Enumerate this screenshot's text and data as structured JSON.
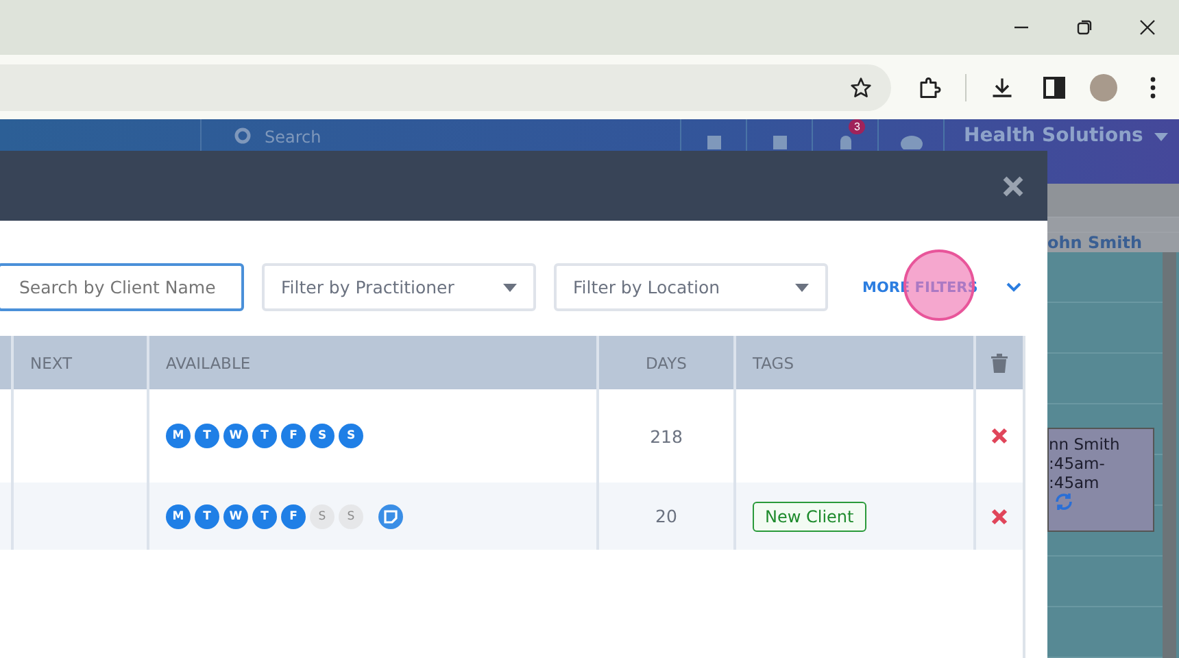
{
  "app_header": {
    "search_placeholder": "Search",
    "notification_count": "3",
    "org_name": "Health Solutions"
  },
  "background_calendar": {
    "column_heading": "ohn Smith",
    "appointment_lines": [
      "nn Smith",
      ":45am-",
      ":45am"
    ]
  },
  "modal": {
    "filters": {
      "search": {
        "placeholder": "Search by Client Name"
      },
      "practitioner": {
        "placeholder": "Filter by Practitioner"
      },
      "location": {
        "placeholder": "Filter by Location"
      },
      "more_filters": "MORE FILTERS"
    },
    "table": {
      "columns": [
        "NEXT",
        "AVAILABLE",
        "DAYS",
        "TAGS"
      ],
      "rows": [
        {
          "days_available": [
            {
              "label": "M",
              "on": true
            },
            {
              "label": "T",
              "on": true
            },
            {
              "label": "W",
              "on": true
            },
            {
              "label": "T",
              "on": true
            },
            {
              "label": "F",
              "on": true
            },
            {
              "label": "S",
              "on": true
            },
            {
              "label": "S",
              "on": true
            }
          ],
          "has_note": false,
          "days": "218",
          "tags": []
        },
        {
          "days_available": [
            {
              "label": "M",
              "on": true
            },
            {
              "label": "T",
              "on": true
            },
            {
              "label": "W",
              "on": true
            },
            {
              "label": "T",
              "on": true
            },
            {
              "label": "F",
              "on": true
            },
            {
              "label": "S",
              "on": false
            },
            {
              "label": "S",
              "on": false
            }
          ],
          "has_note": true,
          "days": "20",
          "tags": [
            "New Client"
          ]
        }
      ]
    }
  }
}
